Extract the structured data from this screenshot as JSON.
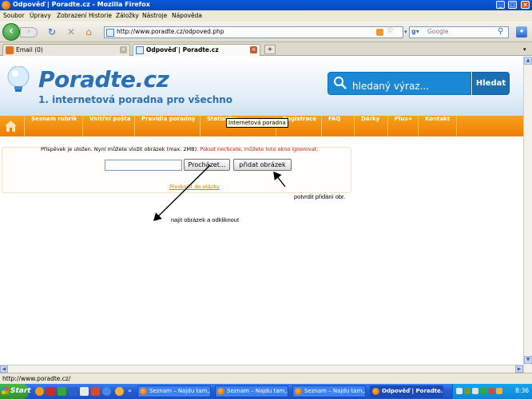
{
  "window": {
    "title": "Odpověď | Poradte.cz - Mozilla Firefox",
    "controls": [
      "_",
      "□",
      "×"
    ]
  },
  "menu": [
    "Soubor",
    "Úpravy",
    "Zobrazení",
    "Historie",
    "Záložky",
    "Nástroje",
    "Nápověda"
  ],
  "toolbar": {
    "url": "http://www.poradte.cz/odpoved.php",
    "search_placeholder": "Google"
  },
  "tabs": [
    {
      "label": "Email (0)",
      "active": false
    },
    {
      "label": "Odpověď | Poradte.cz",
      "active": true
    }
  ],
  "site": {
    "logo": "Poradte.cz",
    "tagline": "1. internetová poradna pro všechno",
    "search_placeholder": "hledaný výraz...",
    "search_button": "Hledat",
    "nav": [
      "Seznam rubrik",
      "Vnitřní pošta",
      "Pravidla poradny",
      "Statistiky",
      "Registrace",
      "FAQ",
      "Dárky",
      "Plus+",
      "Kontakt"
    ],
    "tooltip": "Internetová poradna",
    "upload": {
      "message": "Příspěvek je uložen. Nyní můžete vložit obrázek (max. 2MB).",
      "message_red": "Pokud nechcete, můžete toto okno ignorovat.",
      "browse_button": "Procházet...",
      "add_button": "přidat obrázek",
      "back_link": "Přeskočit do otázky"
    }
  },
  "annotations": {
    "confirm": "potvrdit přidání obr.",
    "find": "najít obrázek a odkliknout"
  },
  "statusbar": "http://www.poradte.cz/",
  "taskbar": {
    "start": "Start",
    "tasks": [
      {
        "label": "Seznam – Najdu tam,...",
        "active": false
      },
      {
        "label": "Seznam – Najdu tam,...",
        "active": false
      },
      {
        "label": "Seznam – Najdu tam,...",
        "active": false
      },
      {
        "label": "Odpověď | Poradte...",
        "active": true
      }
    ],
    "clock": "8:36"
  },
  "colors": {
    "brand_blue": "#2b6fb5",
    "nav_orange": "#f39212",
    "xp_blue": "#245edb"
  }
}
